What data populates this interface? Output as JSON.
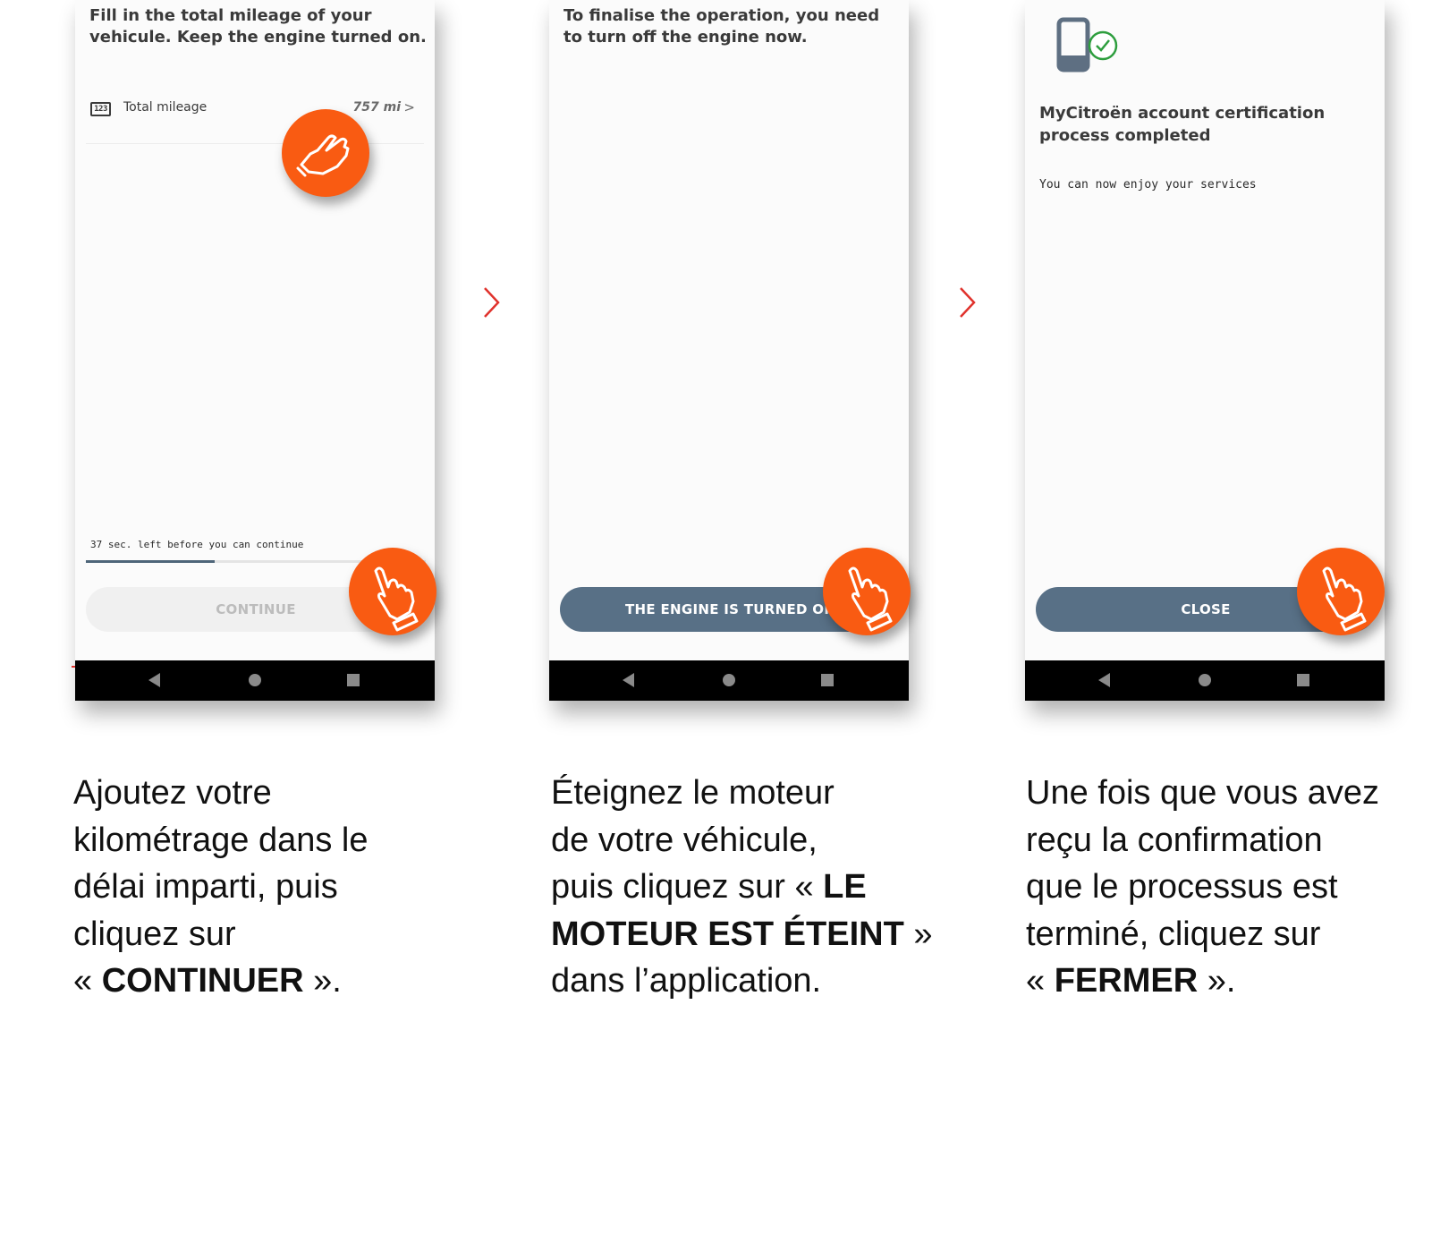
{
  "colors": {
    "tap_orange": "#f95b12",
    "button_blue": "#587086",
    "chevron_red": "#e0322c",
    "success_green": "#2e9e3e",
    "phone_icon": "#5e6f82"
  },
  "icons": {
    "odometer": "odometer-icon",
    "tap_hand": "tap-hand-icon",
    "step_arrow": "chevron-right-icon",
    "phone_check": "phone-check-icon",
    "nav_back": "back-triangle-icon",
    "nav_home": "home-circle-icon",
    "nav_recent": "recent-square-icon"
  },
  "screen1": {
    "heading": "Fill in the total mileage of your vehicule. Keep the engine turned on.",
    "odometer_glyph": "123",
    "mileage_label": "Total mileage",
    "mileage_value": "757 mi",
    "mileage_chevron": ">",
    "timer_text": "37 sec. left before you can continue",
    "timer_progress": 0.38,
    "button_label": "CONTINUE"
  },
  "screen2": {
    "heading": "To finalise the operation, you need to turn off the engine now.",
    "button_label": "THE ENGINE IS TURNED OFF"
  },
  "screen3": {
    "title": "MyCitroën account certification process completed",
    "subtitle": "You can now enjoy your services",
    "button_label": "CLOSE"
  },
  "captions": {
    "step1": {
      "line1": "Ajoutez votre",
      "line2": "kilométrage dans le",
      "line3": "délai imparti, puis",
      "line4": "cliquez sur",
      "open_quote": "« ",
      "bold": "CONTINUER",
      "close_quote": " »."
    },
    "step2": {
      "line1": "Éteignez le moteur",
      "line2": "de votre véhicule,",
      "line3_prefix": "puis cliquez sur « ",
      "bold1": "LE",
      "bold2": "MOTEUR EST ÉTEINT",
      "close_quote": " »",
      "line5": "dans l’application."
    },
    "step3": {
      "line1": "Une fois que vous avez",
      "line2": "reçu la confirmation",
      "line3": "que le processus est",
      "line4": "terminé, cliquez sur",
      "open_quote": "« ",
      "bold": "FERMER",
      "close_quote": " »."
    }
  }
}
